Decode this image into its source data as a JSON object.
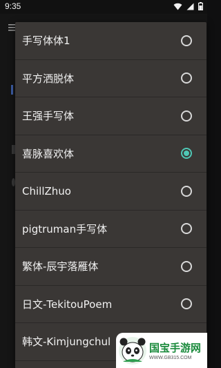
{
  "status_bar": {
    "time": "9:35",
    "icons": [
      "wifi-icon",
      "signal-icon",
      "battery-icon"
    ]
  },
  "dialog": {
    "options": [
      {
        "label": "手写体体1",
        "selected": false
      },
      {
        "label": "平方洒脱体",
        "selected": false
      },
      {
        "label": "王强手写体",
        "selected": false
      },
      {
        "label": "喜脉喜欢体",
        "selected": true
      },
      {
        "label": "ChillZhuo",
        "selected": false
      },
      {
        "label": "pigtruman手写体",
        "selected": false
      },
      {
        "label": "繁体-辰宇落雁体",
        "selected": false
      },
      {
        "label": "日文-TekitouPoem",
        "selected": false
      },
      {
        "label": "韩文-Kimjungchul",
        "selected": false
      }
    ]
  },
  "colors": {
    "accent": "#4fc7b5",
    "dialog_bg": "#3a3735",
    "watermark_green": "#1a8a3c"
  },
  "watermark": {
    "title": "国宝手游网",
    "url": "WWW.GB315.COM"
  }
}
